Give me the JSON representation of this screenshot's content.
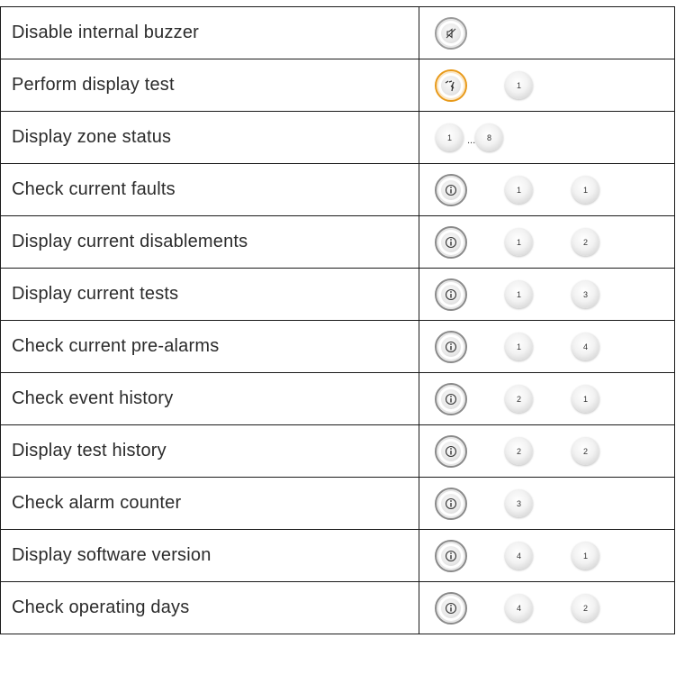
{
  "rows": [
    {
      "label": "Disable internal buzzer",
      "first_key": "buzzer-off-icon",
      "nums": []
    },
    {
      "label": "Perform display test",
      "first_key": "display-test-icon",
      "nums": [
        "1"
      ]
    },
    {
      "label": "Display zone status",
      "first_key": "",
      "nums": [
        "1",
        "8"
      ],
      "ellipsis": "..."
    },
    {
      "label": "Check current faults",
      "first_key": "info-icon",
      "nums": [
        "1",
        "1"
      ]
    },
    {
      "label": "Display current disablements",
      "first_key": "info-icon",
      "nums": [
        "1",
        "2"
      ]
    },
    {
      "label": "Display current tests",
      "first_key": "info-icon",
      "nums": [
        "1",
        "3"
      ]
    },
    {
      "label": "Check current pre-alarms",
      "first_key": "info-icon",
      "nums": [
        "1",
        "4"
      ]
    },
    {
      "label": "Check event history",
      "first_key": "info-icon",
      "nums": [
        "2",
        "1"
      ]
    },
    {
      "label": "Display test history",
      "first_key": "info-icon",
      "nums": [
        "2",
        "2"
      ]
    },
    {
      "label": "Check alarm counter",
      "first_key": "info-icon",
      "nums": [
        "3"
      ]
    },
    {
      "label": "Display software version",
      "first_key": "info-icon",
      "nums": [
        "4",
        "1"
      ]
    },
    {
      "label": "Check operating days",
      "first_key": "info-icon",
      "nums": [
        "4",
        "2"
      ]
    }
  ]
}
